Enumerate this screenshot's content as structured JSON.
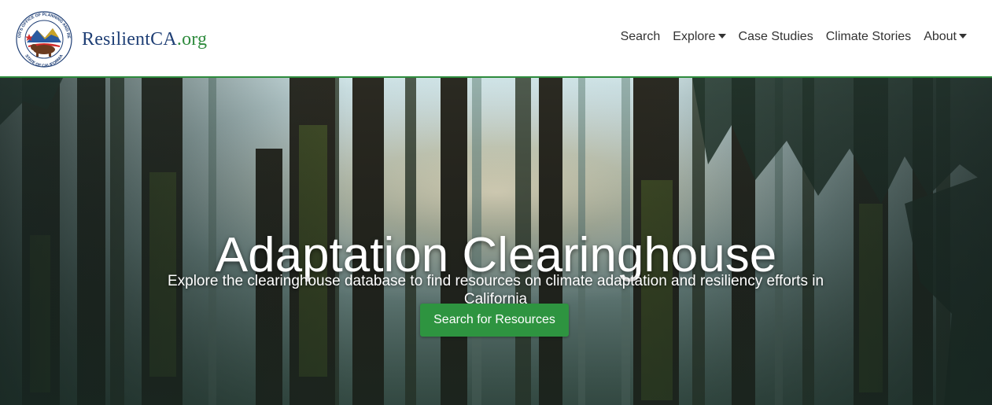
{
  "brand": {
    "seal_top_text": "GOVERNOR'S OFFICE OF PLANNING AND RESEARCH",
    "seal_bottom_text": "STATE OF CALIFORNIA",
    "name": "ResilientCA",
    "tld": ".org"
  },
  "nav": {
    "items": [
      {
        "label": "Search",
        "dropdown": false
      },
      {
        "label": "Explore",
        "dropdown": true
      },
      {
        "label": "Case Studies",
        "dropdown": false
      },
      {
        "label": "Climate Stories",
        "dropdown": false
      },
      {
        "label": "About",
        "dropdown": true
      }
    ]
  },
  "hero": {
    "title": "Adaptation Clearinghouse",
    "subtitle": "Explore the clearinghouse database to find resources on climate adaptation and resiliency efforts in California",
    "button_label": "Search for Resources",
    "background_icon": "forest-photo"
  },
  "colors": {
    "accent_green": "#2e8b3d",
    "button_green": "#2e9440",
    "brand_blue": "#1f3f75"
  }
}
